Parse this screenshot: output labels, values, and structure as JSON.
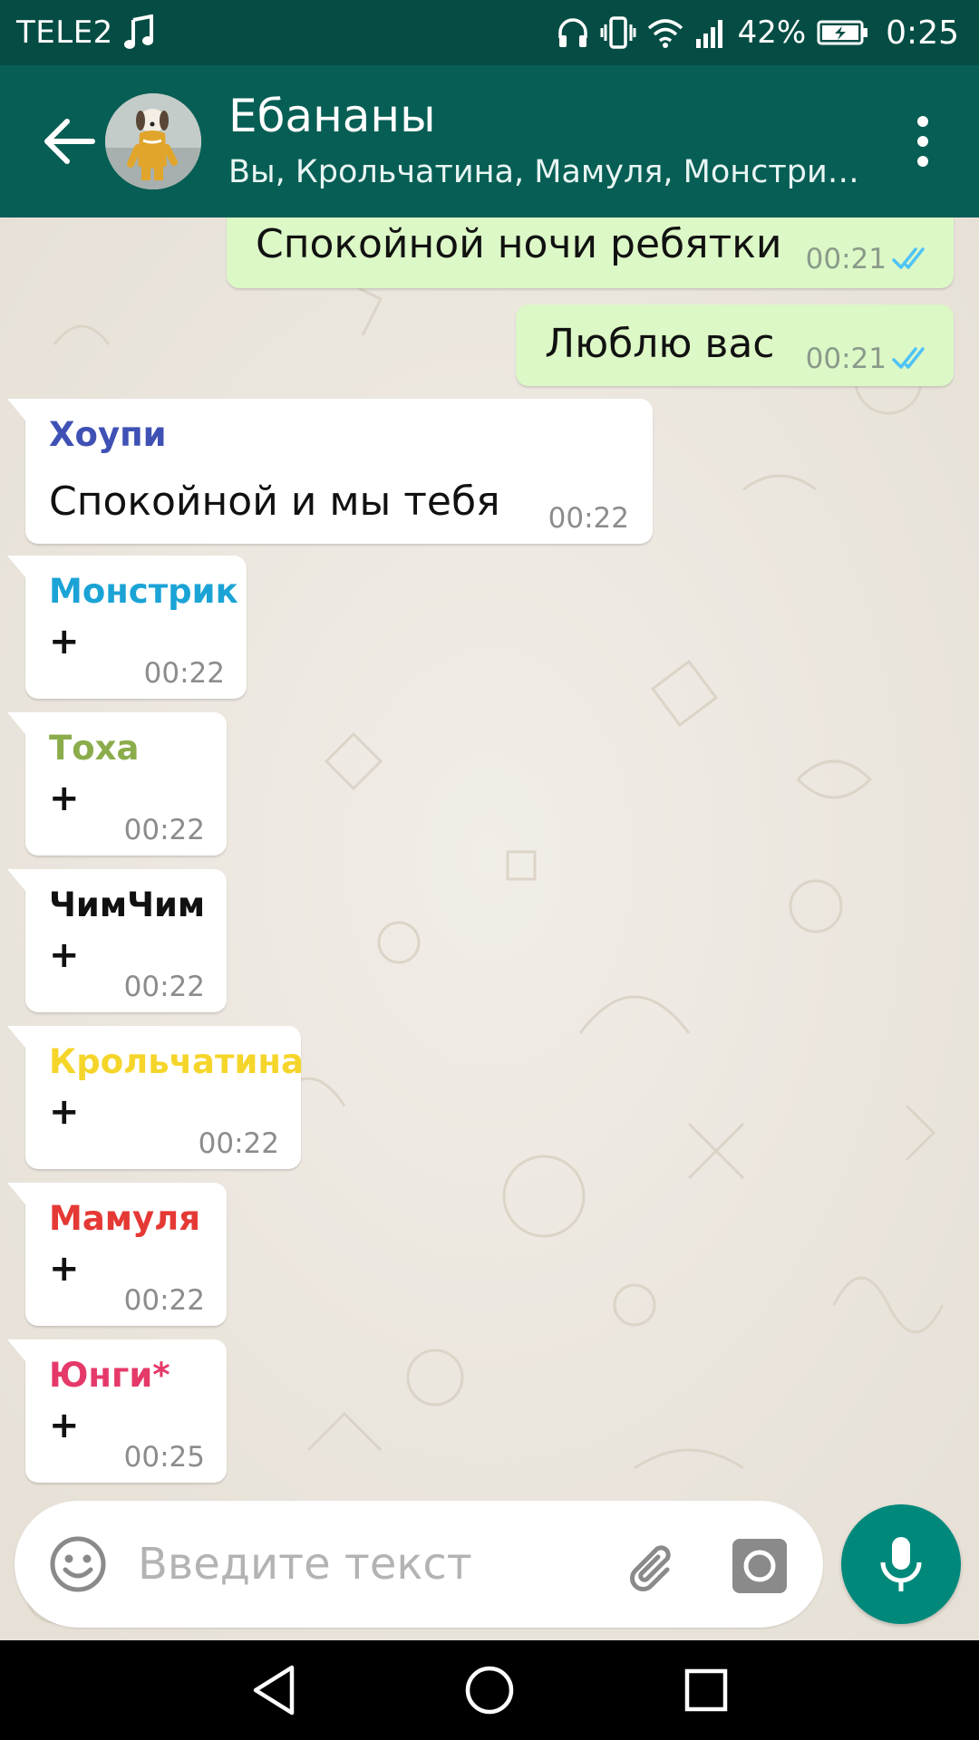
{
  "status_bar": {
    "carrier": "TELE2",
    "battery_percent": "42%",
    "time": "0:25",
    "icons": [
      "music-note-icon",
      "headphones-icon",
      "vibrate-icon",
      "wifi-icon",
      "signal-icon",
      "battery-charging-icon"
    ]
  },
  "header": {
    "title": "Ебананы",
    "members": "Вы, Крольчатина, Мамуля, Монстри…",
    "icons": [
      "arrow-back-icon",
      "group-avatar",
      "more-vert-icon"
    ]
  },
  "messages": [
    {
      "direction": "out",
      "text": "Спокойной ночи ребятки",
      "time": "00:21",
      "status": "read"
    },
    {
      "direction": "out",
      "text": "Люблю вас",
      "time": "00:21",
      "status": "read"
    },
    {
      "direction": "in",
      "sender": "Хоупи",
      "sender_color": "#3f51b5",
      "text": "Спокойной и мы тебя",
      "time": "00:22"
    },
    {
      "direction": "in",
      "sender": "Монстрик",
      "sender_color": "#1ba3d6",
      "text": "+",
      "time": "00:22"
    },
    {
      "direction": "in",
      "sender": "Тоха",
      "sender_color": "#8bac4a",
      "text": "+",
      "time": "00:22"
    },
    {
      "direction": "in",
      "sender": "ЧимЧим",
      "sender_color": "#111111",
      "text": "+",
      "time": "00:22"
    },
    {
      "direction": "in",
      "sender": "Крольчатина",
      "sender_color": "#f5d52a",
      "text": "+",
      "time": "00:22"
    },
    {
      "direction": "in",
      "sender": "Мамуля",
      "sender_color": "#e53935",
      "text": "+",
      "time": "00:22"
    },
    {
      "direction": "in",
      "sender": "Юнги*",
      "sender_color": "#e53969",
      "text": "+",
      "time": "00:25"
    }
  ],
  "composer": {
    "placeholder": "Введите текст",
    "value": "",
    "icons": [
      "emoji-icon",
      "paperclip-icon",
      "camera-icon",
      "microphone-icon"
    ]
  },
  "colors": {
    "status_bar": "#054d44",
    "app_bar": "#075e54",
    "outgoing_bubble": "#dcf8c6",
    "incoming_bubble": "#ffffff",
    "mic_button": "#00897b",
    "read_ticks": "#4fc3f7",
    "nav_bar": "#000000"
  }
}
